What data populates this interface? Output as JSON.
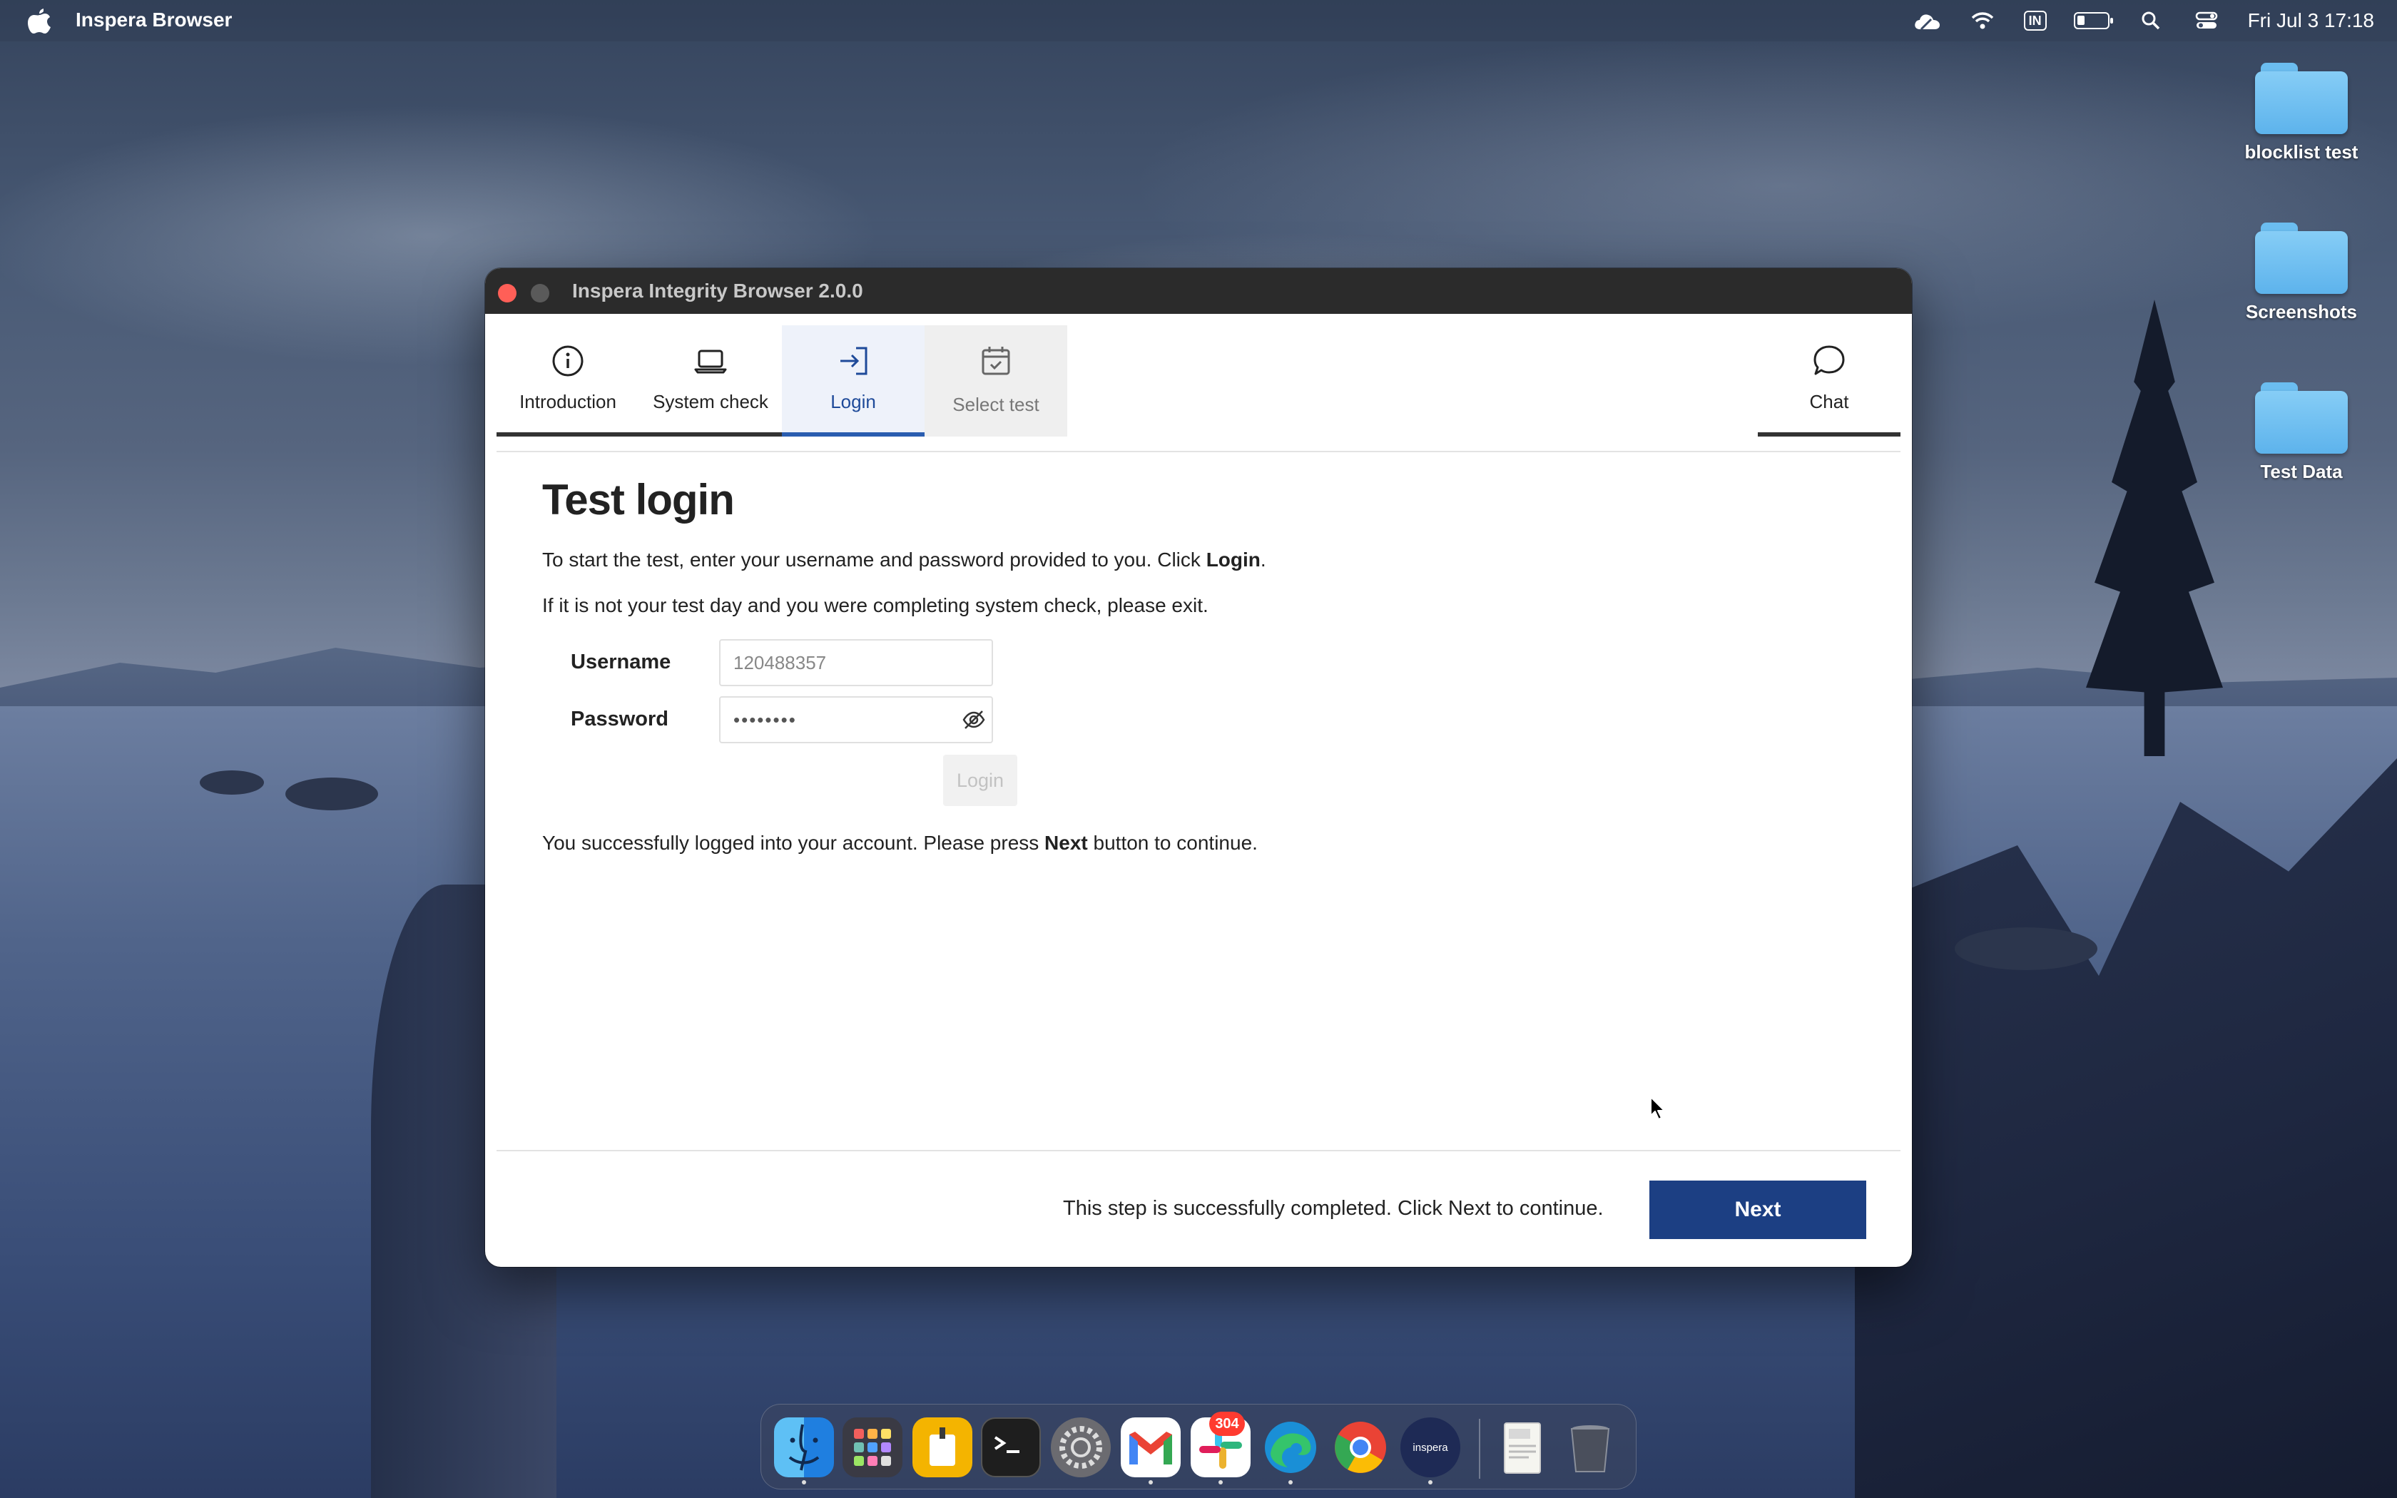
{
  "menubar": {
    "app_name": "Inspera Browser",
    "input_source": "IN",
    "datetime": "Fri Jul 3  17:18"
  },
  "desktop": {
    "folders": [
      {
        "label": "blocklist test"
      },
      {
        "label": "Screenshots"
      },
      {
        "label": "Test Data"
      }
    ]
  },
  "window": {
    "title": "Inspera Integrity Browser 2.0.0",
    "tabs": [
      {
        "label": "Introduction",
        "icon": "info-icon",
        "state": "done"
      },
      {
        "label": "System check",
        "icon": "laptop-icon",
        "state": "done"
      },
      {
        "label": "Login",
        "icon": "login-icon",
        "state": "active"
      },
      {
        "label": "Select test",
        "icon": "calendar-check-icon",
        "state": "disabled"
      }
    ],
    "chat": {
      "label": "Chat",
      "icon": "chat-bubble-icon"
    },
    "page": {
      "heading": "Test login",
      "intro_prefix": "To start the test, enter your username and password provided to you. Click ",
      "intro_bold": "Login",
      "intro_suffix": ".",
      "exit_note": "If it is not your test day and you were completing system check, please exit.",
      "username_label": "Username",
      "username_value": "120488357",
      "password_label": "Password",
      "password_value": "••••••••",
      "login_button": "Login",
      "success_prefix": "You successfully logged into your account. Please press ",
      "success_bold": "Next",
      "success_suffix": " button to continue."
    },
    "footer": {
      "status": "This step is successfully completed. Click Next to continue.",
      "next_button": "Next"
    }
  },
  "dock": {
    "apps": [
      "Finder",
      "Launchpad",
      "Keynote",
      "Terminal",
      "System Settings",
      "Gmail",
      "Slack",
      "Edge",
      "Chrome",
      "Inspera",
      "Document",
      "Trash"
    ],
    "slack_badge": "304",
    "inspera_label": "inspera"
  },
  "colors": {
    "accent": "#1c3f83",
    "tab_active": "#2a5db0",
    "close_button": "#ff5f57",
    "folder": "#6bbdf0"
  }
}
